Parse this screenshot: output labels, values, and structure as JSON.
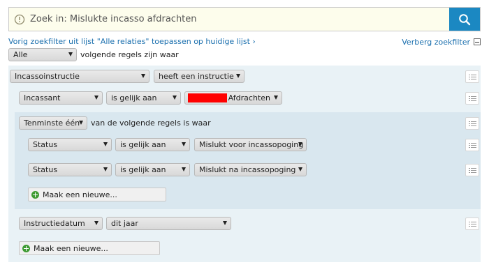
{
  "search": {
    "placeholder": "Zoek in: Mislukte incasso afdrachten"
  },
  "links": {
    "previous_filter": "Vorig zoekfilter uit lijst \"Alle relaties\" toepassen op huidige lijst ›",
    "hide_filter": "Verberg zoekfilter"
  },
  "root": {
    "match_select": "Alle",
    "match_text": "volgende regels zijn waar"
  },
  "rule_incasso": {
    "field": "Incassoinstructie",
    "operator": "heeft een instructie"
  },
  "rule_incassant": {
    "field": "Incassant",
    "operator": "is gelijk aan",
    "value": "Afdrachten"
  },
  "subgroup": {
    "match_select": "Tenminste één",
    "match_text": "van de volgende regels is waar"
  },
  "rule_status_1": {
    "field": "Status",
    "operator": "is gelijk aan",
    "value": "Mislukt voor incassopoging"
  },
  "rule_status_2": {
    "field": "Status",
    "operator": "is gelijk aan",
    "value": "Mislukt na incassopoging"
  },
  "subgroup_new": {
    "label": "Maak een nieuwe..."
  },
  "rule_date": {
    "field": "Instructiedatum",
    "operator": "dit jaar"
  },
  "group_new": {
    "label": "Maak een nieuwe..."
  },
  "colors": {
    "search_button": "#1b88c2",
    "link": "#1a6fae",
    "group_bg": "#e9f2f6",
    "subgroup_bg": "#d9e7ef",
    "plus": "#3e9b33",
    "redaction": "#ff0000"
  },
  "icons": {
    "search": "search-icon",
    "warning": "warning-icon",
    "list": "list-icon",
    "add": "plus-circle-icon",
    "collapse": "minus-box-icon"
  }
}
